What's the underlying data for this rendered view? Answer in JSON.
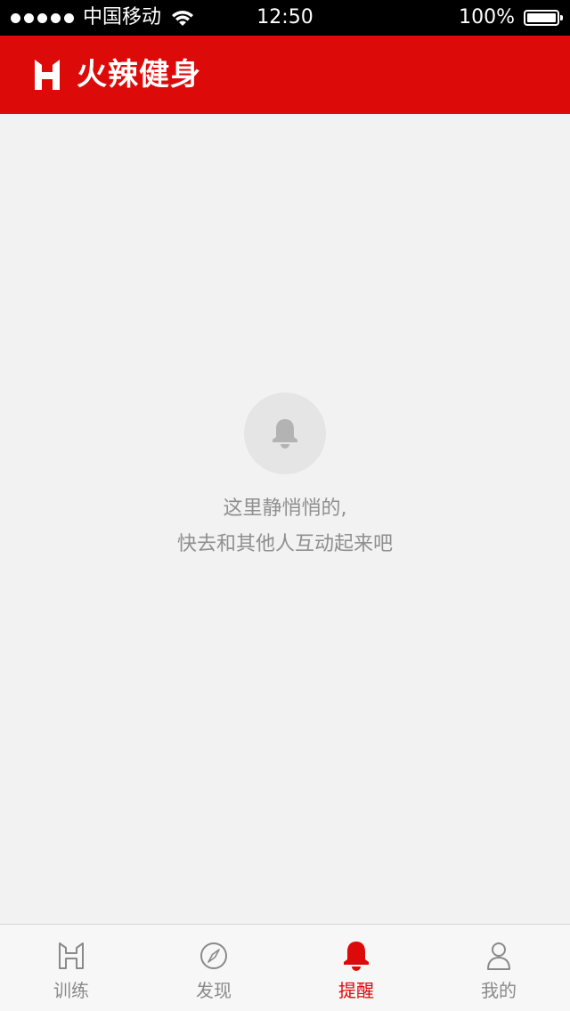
{
  "status_bar": {
    "carrier": "中国移动",
    "time": "12:50",
    "battery": "100%"
  },
  "header": {
    "title": "火辣健身",
    "logo_icon": "hotfitness-logo-icon",
    "background_color": "#dd0a0a"
  },
  "empty_state": {
    "icon": "bell-icon",
    "line1": "这里静悄悄的,",
    "line2": "快去和其他人互动起来吧"
  },
  "tabs": [
    {
      "label": "训练",
      "icon": "training-logo-icon",
      "active": false
    },
    {
      "label": "发现",
      "icon": "compass-icon",
      "active": false
    },
    {
      "label": "提醒",
      "icon": "bell-icon",
      "active": true
    },
    {
      "label": "我的",
      "icon": "user-icon",
      "active": false
    }
  ],
  "colors": {
    "accent": "#dd0a0a",
    "inactive": "#8a8a8a",
    "background": "#f2f2f2"
  }
}
